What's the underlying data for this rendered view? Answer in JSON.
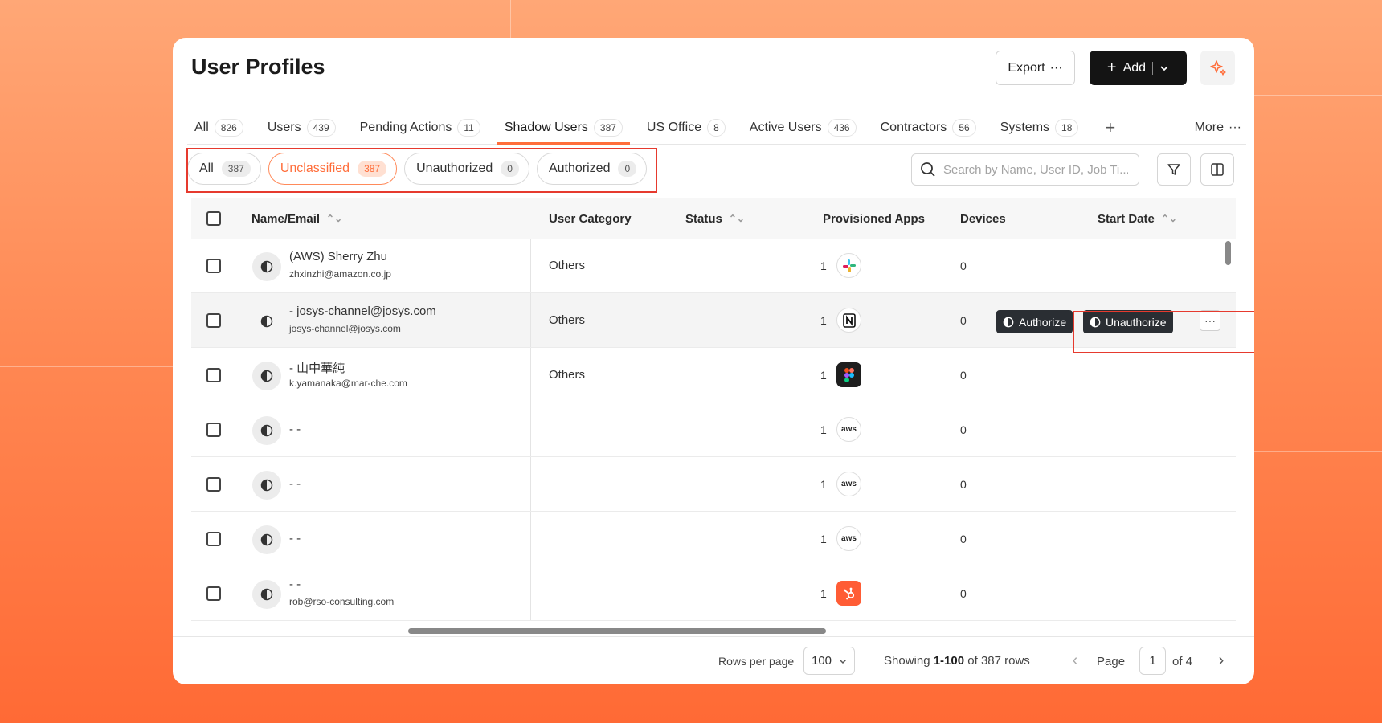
{
  "header": {
    "title": "User Profiles",
    "export_label": "Export",
    "add_label": "Add"
  },
  "tabs": [
    {
      "label": "All",
      "count": "826"
    },
    {
      "label": "Users",
      "count": "439"
    },
    {
      "label": "Pending Actions",
      "count": "11"
    },
    {
      "label": "Shadow Users",
      "count": "387",
      "active": true
    },
    {
      "label": "US Office",
      "count": "8"
    },
    {
      "label": "Active Users",
      "count": "436"
    },
    {
      "label": "Contractors",
      "count": "56"
    },
    {
      "label": "Systems",
      "count": "18"
    }
  ],
  "tabs_more_label": "More",
  "filters": [
    {
      "label": "All",
      "count": "387"
    },
    {
      "label": "Unclassified",
      "count": "387",
      "active": true
    },
    {
      "label": "Unauthorized",
      "count": "0"
    },
    {
      "label": "Authorized",
      "count": "0"
    }
  ],
  "search": {
    "placeholder": "Search by Name, User ID, Job Ti..."
  },
  "columns": {
    "name": "Name/Email",
    "category": "User Category",
    "status": "Status",
    "apps": "Provisioned Apps",
    "devices": "Devices",
    "start_date": "Start Date"
  },
  "rows": [
    {
      "name": "(AWS) Sherry Zhu",
      "email": "zhxinzhi@amazon.co.jp",
      "category": "Others",
      "apps": "1",
      "app_icon": "slack-icon",
      "devices": "0"
    },
    {
      "name": "- josys-channel@josys.com",
      "email": "josys-channel@josys.com",
      "category": "Others",
      "apps": "1",
      "app_icon": "notion-icon",
      "devices": "0"
    },
    {
      "name": "- 山中華純",
      "email": "k.yamanaka@mar-che.com",
      "category": "Others",
      "apps": "1",
      "app_icon": "figma-icon",
      "devices": "0"
    },
    {
      "name": "- -",
      "email": "",
      "category": "",
      "apps": "1",
      "app_icon": "aws-icon",
      "devices": "0"
    },
    {
      "name": "- -",
      "email": "",
      "category": "",
      "apps": "1",
      "app_icon": "aws-icon",
      "devices": "0"
    },
    {
      "name": "- -",
      "email": "",
      "category": "",
      "apps": "1",
      "app_icon": "aws-icon",
      "devices": "0"
    },
    {
      "name": "- -",
      "email": "rob@rso-consulting.com",
      "category": "",
      "apps": "1",
      "app_icon": "hubspot-icon",
      "devices": "0"
    }
  ],
  "row_actions": {
    "authorize": "Authorize",
    "unauthorize": "Unauthorize"
  },
  "aws_text": "aws",
  "footer": {
    "rows_per_page_label": "Rows per page",
    "rows_per_page_value": "100",
    "showing_prefix": "Showing",
    "showing_range": "1-100",
    "showing_suffix": "of 387 rows",
    "page_label": "Page",
    "page_value": "1",
    "page_total": "of 4"
  },
  "colors": {
    "accent": "#ff6d3a",
    "dark": "#141414",
    "highlight_box": "#e63a2e"
  }
}
